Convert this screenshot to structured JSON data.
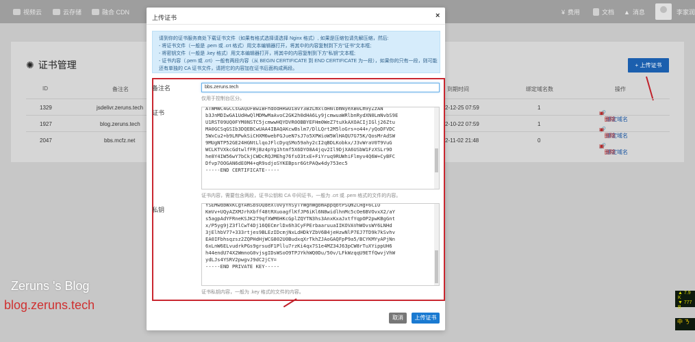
{
  "topbar": {
    "nav": [
      {
        "icon": "video-icon",
        "label": "视频云"
      },
      {
        "icon": "cloud-icon",
        "label": "云存储"
      },
      {
        "icon": "cdn-icon",
        "label": "融合 CDN"
      }
    ],
    "right": [
      {
        "icon": "yen-icon",
        "label": "费用"
      },
      {
        "icon": "doc-icon",
        "label": "文档"
      },
      {
        "icon": "bell-icon",
        "label": "消息"
      }
    ],
    "username": "李家润"
  },
  "background": {
    "title": "证书管理",
    "upload_button": "+ 上传证书",
    "headers": [
      "ID",
      "备注名",
      "到期时间",
      "绑定域名数",
      "操作"
    ],
    "rows": [
      {
        "id": "1329",
        "name": "jsdelivr.zeruns.tech",
        "expire": "2-12-25 07:59",
        "count": "1",
        "bind": "绑定域名",
        "delete": "删除"
      },
      {
        "id": "1927",
        "name": "blog.zeruns.tech",
        "expire": "2-10-22 07:59",
        "count": "1",
        "bind": "绑定域名",
        "delete": "删除"
      },
      {
        "id": "2047",
        "name": "bbs.mcfz.net",
        "expire": "2-11-02 21:48",
        "count": "0",
        "bind": "绑定域名",
        "delete": "删除"
      }
    ]
  },
  "watermark": {
    "line1": "Zeruns 's Blog",
    "line2": "blog.zeruns.tech"
  },
  "ticker": {
    "line1": "▲ 7.9 K",
    "line2": "▼ 777 B",
    "badge": "中 ㄋ"
  },
  "modal": {
    "title": "上传证书",
    "close": "×",
    "notice": [
      "请到你的证书服务商处下载证书文件（如果有格式选择请选择 Nginx 格式）, 如果是压缩包请先解压缩，然后:",
      "- 将证书文件（一般是 .pem 或 .crt 格式）用文本编辑器打开，将其中的内容复制到下方\"证书\"文本框;",
      "- 将密钥文件（一般是 .key 格式）用文本编辑器打开，将其中的内容复制到下方\"私钥\"文本框;",
      "- 证书内容（.pem 或 .crt）一般有两段内容（从 BEGIN CERTIFICATE 到 END CERTIFICATE 为一段），如果你的只有一段，则可能",
      "还有单独的 CA 证书文件，请把它的内容加在证书后面构成两段。"
    ],
    "alias_label": "备注名",
    "alias_value": "bbs.zeruns.tech",
    "alias_help": "仅用于控制台区分。",
    "cert_label": "证书",
    "cert_lines": [
      "ATWMWC4GCCsGAQUFBwIBFhdodHRwOi8vY3BzLmxldHNlbmNyeXB0Lm9yZzAN",
      "b3JnMDIwGA1UdHwQlMDMwMaAvoC2GK2h0dHA6Ly9jcmwuaWRlbnRydXN0LmNvbS9E",
      "U1RST09UQ0FYM0NSTC5jcmwwHQYDVR0OBBYEFHm0WeZ7tuXkAXOACIjIGlj26Ztu",
      "MA0GCSqGSIb3DQEBCwUAA4IBAQAKcwBslm7/DlLQrt2M5loGrs+o44+/yQoDFVDC",
      "5WxCu2+b9LRPwkSiCHXM6webFGJueN7sJ7o5XPWioW5WlHAQU7G75K/QosMrAdSW",
      "9MUgNTP52GE24HGNtLlqoJFlcDyqSMo59ahy2cI2qBDLKobkx/J3vWraV0T9VuG",
      "WCLKTVXkcGdtwlfFRjBz4pYg1htmf5X6DYO8A4jqv2Il9DjXA6USbW1FzXSLr9O",
      "he8Y4IW56wY7bCkjCWDcRQJMEhg76fsO3txE+FiYruq9RUWhiFlmyv4Q6W+CyBFC",
      "Dfvp7OOGAN6dEOM4+qR9sdjoSYKEBpsr6GtPAQw4dy753ec5",
      "-----END CERTIFICATE-----"
    ],
    "cert_help": "证书内容，需要包含两段，证书公钥和 CA 中间证书，一般为 .crt 或 .pem 格式的文件的内容。",
    "key_label": "私钥",
    "key_lines": [
      "YSEMwdbWxKCgYAmSbsOQdeXl0vyYnSyTYWgnWgbmAppqbtPSQmZCHg+6CIO",
      "KmVv+UQyAZXMJrhXbff48tRXuoagflKfJP6iKl6N8widlhnMc5cOe6BVOvxX2/aY",
      "s5agpAdYFRneKSJK279qfXWM6HKcGplZQYTN3hs3AnxKxaJxtfYqpOP2pwKBgGnt",
      "x/P5yg9jZ3flCwT4Dj16QECmrlDx6h3CyFPErbaaruuaIIKOVAVhWOvsWY6LNHd",
      "3jElhbV77+333rtjes9BLEzIDcmjNxLdHDkYZbV6B4jeHzwNlP7EJ7TD9k7kSvhv",
      "EA0IFbhsqzsz2ZQPHdHjWCG802U0BudxqXrTkhZJAoGAQFpP9a5/BCYKMYyAPjNn",
      "6xLnW6ELvudrkPGs9grsudF1Pllu7rzKi4qx7S1e4MZ34J63pCW8rTuXYippUH6",
      "h44endU74X2WmnoG0vjsgIDsWSoO9TPJYkhWQ0Du/50v/LFkWzqqU9ETfQwvjVhW",
      "ydLJs4YSRV2pwgvJ9dC2jCY=",
      "-----END PRIVATE KEY-----"
    ],
    "key_help": "证书私钥内容，一般为 .key 格式的文件的内容。",
    "cancel": "取消",
    "upload": "上传证书"
  }
}
